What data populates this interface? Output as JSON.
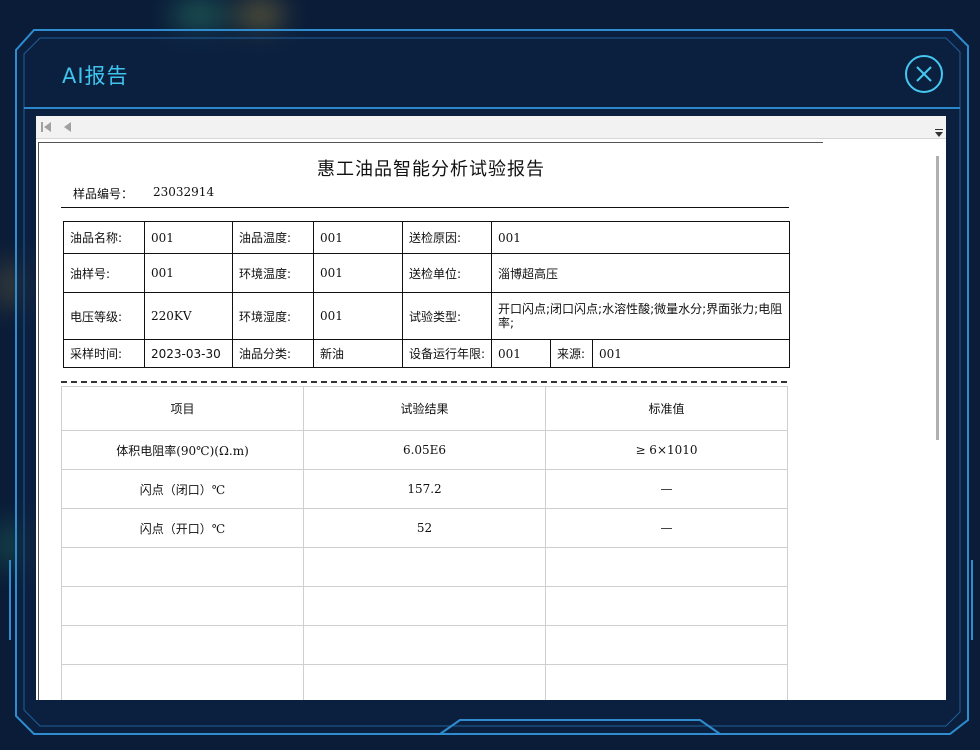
{
  "dialog": {
    "title": "AI报告"
  },
  "report": {
    "title": "惠工油品智能分析试验报告",
    "sample_no_label": "样品编号：",
    "sample_no": "23032914",
    "info": {
      "oil_name_label": "油品名称:",
      "oil_name": "001",
      "oil_temp_label": "油品温度:",
      "oil_temp": "001",
      "reason_label": "送检原因:",
      "reason": "001",
      "oil_sample_no_label": "油样号:",
      "oil_sample_no": "001",
      "env_temp_label": "环境温度:",
      "env_temp": "001",
      "unit_label": "送检单位:",
      "unit": "淄博超高压",
      "voltage_label": "电压等级:",
      "voltage": "220KV",
      "env_humidity_label": "环境湿度:",
      "env_humidity": "001",
      "test_type_label": "试验类型:",
      "test_type": "开口闪点;闭口闪点;水溶性酸;微量水分;界面张力;电阻率;",
      "sampling_time_label": "采样时间:",
      "sampling_time": "2023-03-30",
      "oil_class_label": "油品分类:",
      "oil_class": "新油",
      "run_years_label": "设备运行年限:",
      "run_years": "001",
      "source_label": "来源:",
      "source": "001"
    },
    "results": {
      "headers": [
        "项目",
        "试验结果",
        "标准值"
      ],
      "rows": [
        [
          "体积电阻率(90℃)(Ω.m)",
          "6.05E6",
          "≥ 6×1010"
        ],
        [
          "闪点（闭口）℃",
          "157.2",
          "—"
        ],
        [
          "闪点（开口）℃",
          "52",
          "—"
        ],
        [
          "",
          "",
          ""
        ],
        [
          "",
          "",
          ""
        ],
        [
          "",
          "",
          ""
        ],
        [
          "",
          "",
          ""
        ]
      ]
    }
  }
}
